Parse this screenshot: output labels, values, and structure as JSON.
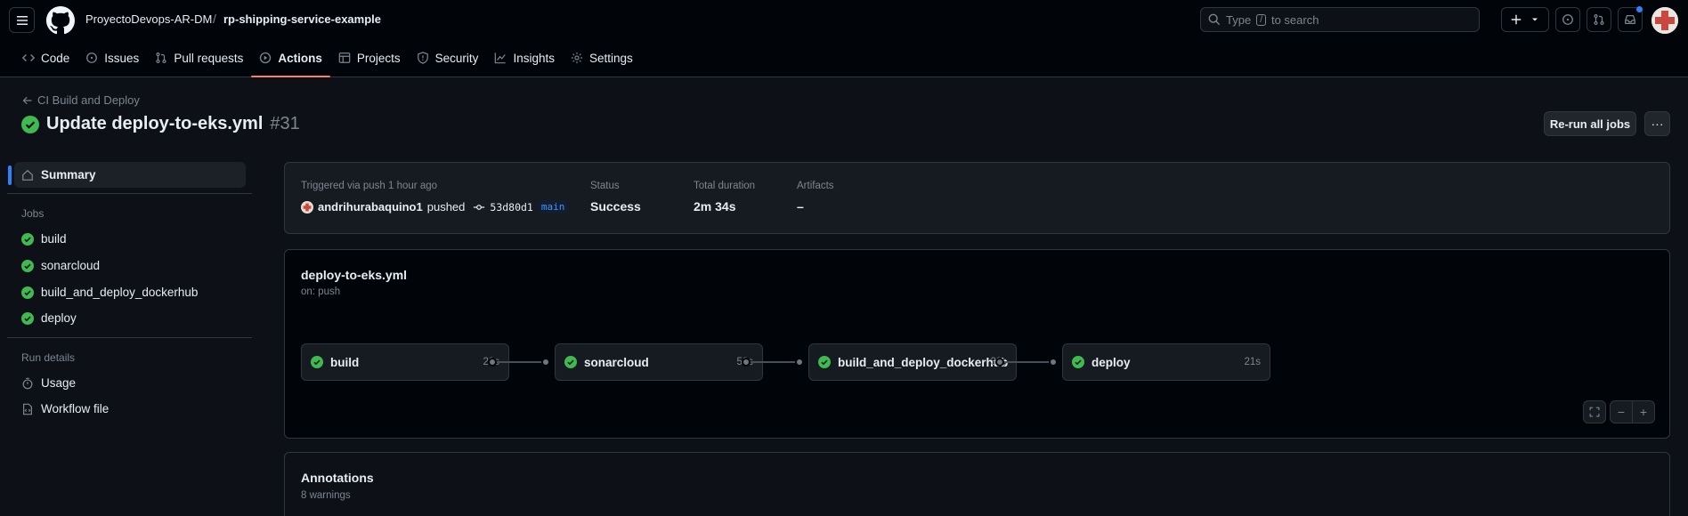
{
  "header": {
    "owner": "ProyectoDevops-AR-DM",
    "separator": "/",
    "repo": "rp-shipping-service-example",
    "search_placeholder_pre": "Type",
    "search_key": "/",
    "search_placeholder_post": "to search"
  },
  "tabs": [
    {
      "label": "Code",
      "icon": "code-icon"
    },
    {
      "label": "Issues",
      "icon": "issue-icon"
    },
    {
      "label": "Pull requests",
      "icon": "pull-request-icon"
    },
    {
      "label": "Actions",
      "icon": "play-icon",
      "active": true
    },
    {
      "label": "Projects",
      "icon": "table-icon"
    },
    {
      "label": "Security",
      "icon": "shield-icon"
    },
    {
      "label": "Insights",
      "icon": "graph-icon"
    },
    {
      "label": "Settings",
      "icon": "gear-icon"
    }
  ],
  "run": {
    "back_label": "CI Build and Deploy",
    "title": "Update deploy-to-eks.yml",
    "number": "#31",
    "rerun_label": "Re-run all jobs",
    "more_label": "···"
  },
  "sidebar": {
    "summary": "Summary",
    "jobs_heading": "Jobs",
    "jobs": [
      "build",
      "sonarcloud",
      "build_and_deploy_dockerhub",
      "deploy"
    ],
    "run_details_heading": "Run details",
    "details": [
      "Usage",
      "Workflow file"
    ]
  },
  "summary": {
    "trigger_label": "Triggered via push 1 hour ago",
    "user": "andrihurabaquino1",
    "action": "pushed",
    "commit": "53d80d1",
    "branch": "main",
    "status_label": "Status",
    "status_value": "Success",
    "duration_label": "Total duration",
    "duration_value": "2m 34s",
    "artifacts_label": "Artifacts",
    "artifacts_value": "–"
  },
  "workflow": {
    "file": "deploy-to-eks.yml",
    "on": "on: push",
    "jobs": [
      {
        "name": "build",
        "duration": "20s"
      },
      {
        "name": "sonarcloud",
        "duration": "50s"
      },
      {
        "name": "build_and_deploy_dockerhub",
        "duration": "32s"
      },
      {
        "name": "deploy",
        "duration": "21s"
      }
    ],
    "zoom_out": "−",
    "zoom_in": "+"
  },
  "annotations": {
    "title": "Annotations",
    "count": "8 warnings"
  },
  "colors": {
    "success": "#3fb950",
    "accent": "#2f81f7",
    "tab_underline": "#f78166"
  }
}
